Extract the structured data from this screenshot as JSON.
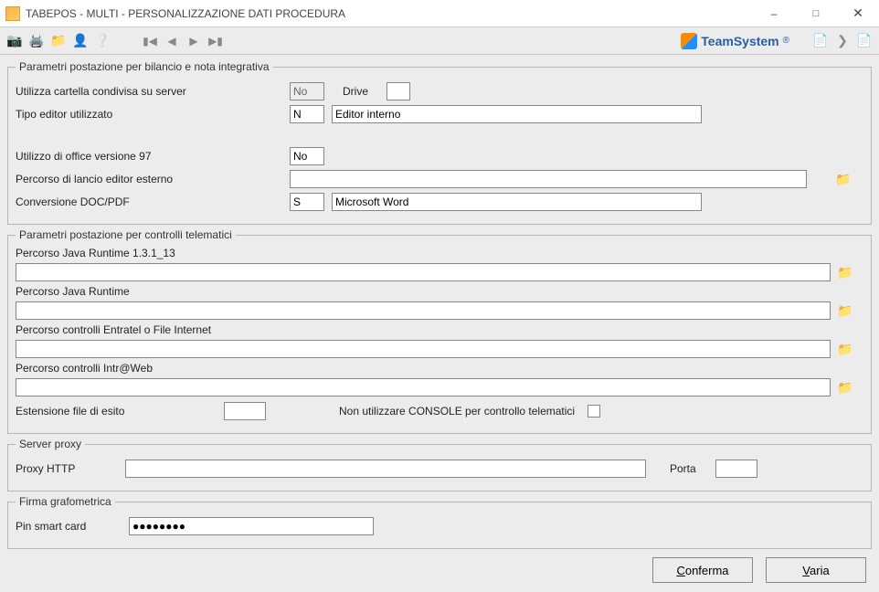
{
  "window": {
    "title": "TABEPOS  - MULTI -  PERSONALIZZAZIONE DATI PROCEDURA"
  },
  "brand": {
    "name": "TeamSystem",
    "suffix": "®"
  },
  "group1": {
    "legend": "Parametri postazione per bilancio e nota integrativa",
    "shared_folder_label": "Utilizza cartella condivisa su server",
    "shared_folder_value": "No",
    "drive_label": "Drive",
    "drive_value": "",
    "editor_type_label": "Tipo editor utilizzato",
    "editor_type_value": "N",
    "editor_desc_value": "Editor interno",
    "office97_label": "Utilizzo di office versione 97",
    "office97_value": "No",
    "launch_path_label": "Percorso di lancio editor esterno",
    "launch_path_value": "",
    "conv_label": "Conversione DOC/PDF",
    "conv_value": "S",
    "conv_desc_value": "Microsoft Word"
  },
  "group2": {
    "legend": "Parametri postazione per controlli telematici",
    "java131_label": "Percorso Java Runtime 1.3.1_13",
    "java131_value": "",
    "java_label": "Percorso Java Runtime",
    "java_value": "",
    "entratel_label": "Percorso controlli Entratel o File Internet",
    "entratel_value": "",
    "intraweb_label": "Percorso controlli Intr@Web",
    "intraweb_value": "",
    "ext_label": "Estensione file di esito",
    "ext_value": "",
    "noconsole_label": "Non utilizzare CONSOLE per controllo telematici"
  },
  "group3": {
    "legend": "Server proxy",
    "proxy_label": "Proxy HTTP",
    "proxy_value": "",
    "port_label": "Porta",
    "port_value": ""
  },
  "group4": {
    "legend": "Firma grafometrica",
    "pin_label": "Pin smart card",
    "pin_value": "●●●●●●●●"
  },
  "buttons": {
    "confirm": "Conferma",
    "vary": "Varia"
  }
}
